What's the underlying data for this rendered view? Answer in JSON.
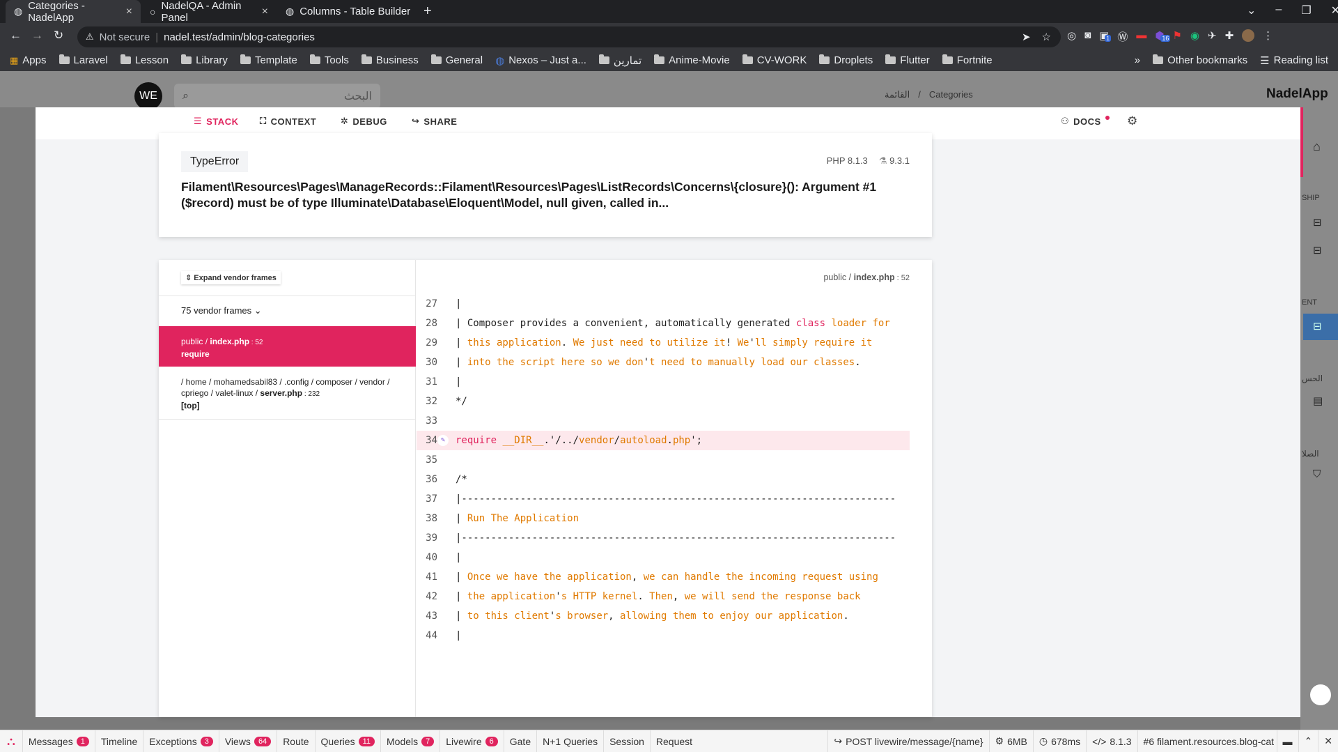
{
  "browser": {
    "tabs": [
      {
        "title": "Categories - NadelApp",
        "active": true
      },
      {
        "title": "NadelQA - Admin Panel",
        "active": false
      },
      {
        "title": "Columns - Table Builder - F",
        "active": false
      }
    ],
    "new_tab": "+",
    "security": "Not secure",
    "url": "nadel.test/admin/blog-categories",
    "bookmarks": [
      "Apps",
      "Laravel",
      "Lesson",
      "Library",
      "Template",
      "Tools",
      "Business",
      "General",
      "Nexos – Just a...",
      "تمارين",
      "Anime-Movie",
      "CV-WORK",
      "Droplets",
      "Flutter",
      "Fortnite"
    ],
    "bookmarks_more": "»",
    "other_bookmarks": "Other bookmarks",
    "reading_list": "Reading list",
    "ext_badges": [
      "1",
      "16"
    ]
  },
  "app": {
    "avatar": "WE",
    "search_placeholder": "البحث",
    "breadcrumb": [
      "القائمة",
      "Categories"
    ],
    "brand": "NadelApp",
    "side_labels": [
      "SHIP",
      "ENT",
      "الحس",
      "الصلا"
    ]
  },
  "ignition": {
    "tabs": [
      "STACK",
      "CONTEXT",
      "DEBUG",
      "SHARE"
    ],
    "docs": "DOCS",
    "error_type": "TypeError",
    "php_version": "PHP 8.1.3",
    "laravel_version": "9.3.1",
    "message": "Filament\\Resources\\Pages\\ManageRecords::Filament\\Resources\\Pages\\ListRecords\\Concerns\\{closure}(): Argument #1 ($record) must be of type Illuminate\\Database\\Eloquent\\Model, null given, called in...",
    "expand_vendor": "Expand vendor frames",
    "vendor_frames": "75 vendor frames",
    "frames": [
      {
        "path": "public / ",
        "file": "index.php",
        "line": " : 52",
        "method": "require",
        "active": true
      },
      {
        "path": "/ home / mohamedsabil83 / .config / composer / vendor / cpriego / valet-linux / ",
        "file": "server.php",
        "line": " : 232",
        "method": "[top]",
        "active": false
      }
    ],
    "file_header": {
      "path": "public / ",
      "file": "index.php",
      "line": " : 52"
    },
    "code": [
      {
        "n": "27",
        "t": "|"
      },
      {
        "n": "28",
        "t": "| Composer provides a convenient, automatically generated class loader for"
      },
      {
        "n": "29",
        "t": "| this application. We just need to utilize it! We'll simply require it"
      },
      {
        "n": "30",
        "t": "| into the script here so we don't need to manually load our classes."
      },
      {
        "n": "31",
        "t": "|"
      },
      {
        "n": "32",
        "t": "*/"
      },
      {
        "n": "33",
        "t": ""
      },
      {
        "n": "34",
        "t": "require __DIR__.'/../vendor/autoload.php';"
      },
      {
        "n": "35",
        "t": ""
      },
      {
        "n": "36",
        "t": "/*"
      },
      {
        "n": "37",
        "t": "|--------------------------------------------------------------------------"
      },
      {
        "n": "38",
        "t": "| Run The Application"
      },
      {
        "n": "39",
        "t": "|--------------------------------------------------------------------------"
      },
      {
        "n": "40",
        "t": "|"
      },
      {
        "n": "41",
        "t": "| Once we have the application, we can handle the incoming request using"
      },
      {
        "n": "42",
        "t": "| the application's HTTP kernel. Then, we will send the response back"
      },
      {
        "n": "43",
        "t": "| to this client's browser, allowing them to enjoy our application."
      },
      {
        "n": "44",
        "t": "|"
      }
    ]
  },
  "debugbar": {
    "items": [
      {
        "label": "Messages",
        "badge": "1"
      },
      {
        "label": "Timeline",
        "badge": ""
      },
      {
        "label": "Exceptions",
        "badge": "3"
      },
      {
        "label": "Views",
        "badge": "64"
      },
      {
        "label": "Route",
        "badge": ""
      },
      {
        "label": "Queries",
        "badge": "11"
      },
      {
        "label": "Models",
        "badge": "7"
      },
      {
        "label": "Livewire",
        "badge": "6"
      },
      {
        "label": "Gate",
        "badge": ""
      },
      {
        "label": "N+1 Queries",
        "badge": ""
      },
      {
        "label": "Session",
        "badge": ""
      },
      {
        "label": "Request",
        "badge": ""
      }
    ],
    "request": "POST livewire/message/{name}",
    "memory": "6MB",
    "time": "678ms",
    "php": "8.1.3",
    "route_select": "#6 filament.resources.blog-cat"
  },
  "colors": {
    "accent": "#e0245e",
    "code_orange": "#e07a00"
  }
}
